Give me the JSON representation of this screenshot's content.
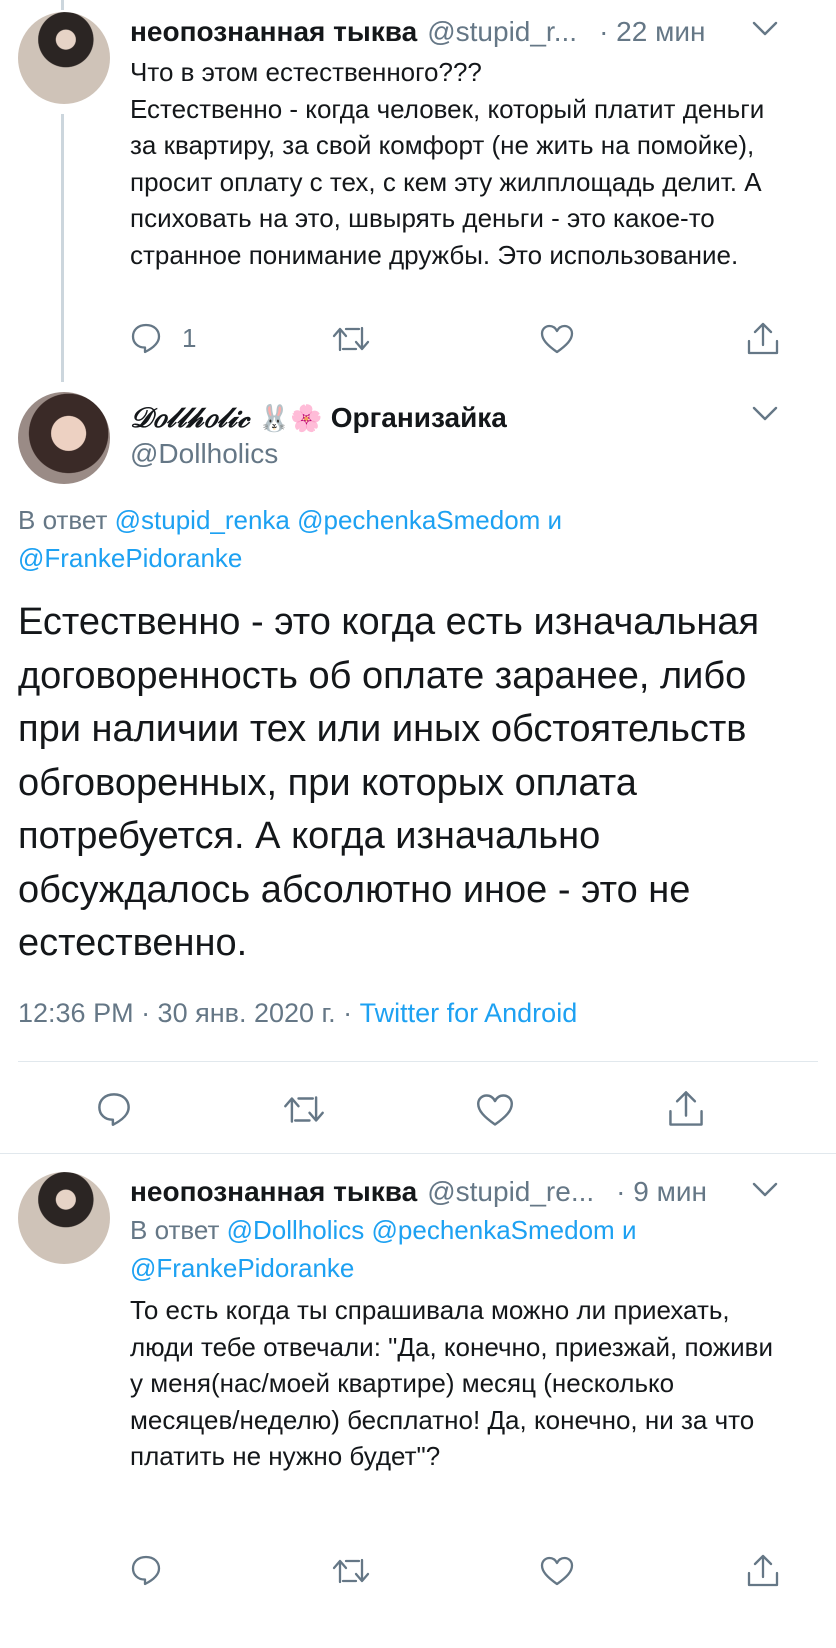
{
  "tweets": [
    {
      "name": "неопознанная тыква",
      "handle": "@stupid_r...",
      "time": "· 22 мин",
      "text": "Что в этом естественного???\nЕстественно - когда человек, который платит деньги за квартиру, за свой комфорт (не жить на помойке), просит оплату с тех, с кем эту жилплощадь делит. А психовать на это, швырять деньги - это какое-то странное понимание дружбы. Это использование.",
      "reply_count": "1"
    }
  ],
  "main_tweet": {
    "name": "𝒟𝑜𝓁𝓁𝒽𝑜𝓁𝒾𝒸",
    "name_emoji": "🐰🌸",
    "name_suffix": "Организайка",
    "handle": "@Dollholics",
    "reply_prefix": "В ответ",
    "reply_users": "@stupid_renka @pechenkaSmedom",
    "reply_and": "и",
    "reply_user_last": "@FrankePidoranke",
    "text": "Естественно - это когда есть изначальная договоренность об оплате заранее, либо при наличии тех или иных обстоятельств обговоренных, при которых оплата потребуется. А когда изначально обсуждалось абсолютно иное - это не естественно.",
    "timestamp": "12:36 PM · 30 янв. 2020 г. ·",
    "source": "Twitter for Android"
  },
  "reply_tweet": {
    "name": "неопознанная тыква",
    "handle": "@stupid_re...",
    "time": "· 9 мин",
    "reply_prefix": "В ответ",
    "reply_users": "@Dollholics @pechenkaSmedom",
    "reply_and": "и",
    "reply_user_last": "@FrankePidoranke",
    "text": "То есть когда ты спрашивала можно ли приехать, люди тебе отвечали: \"Да, конечно, приезжай, поживи у меня(нас/моей квартире) месяц (несколько месяцев/неделю) бесплатно! Да, конечно, ни за что платить не нужно будет\"?"
  },
  "icons": {
    "reply": "reply-icon",
    "retweet": "retweet-icon",
    "like": "heart-icon",
    "share": "share-icon",
    "menu": "chevron-down-icon"
  },
  "colors": {
    "link": "#1da1f2",
    "secondary": "#657786",
    "text": "#14171a",
    "divider": "#e1e8ed"
  }
}
